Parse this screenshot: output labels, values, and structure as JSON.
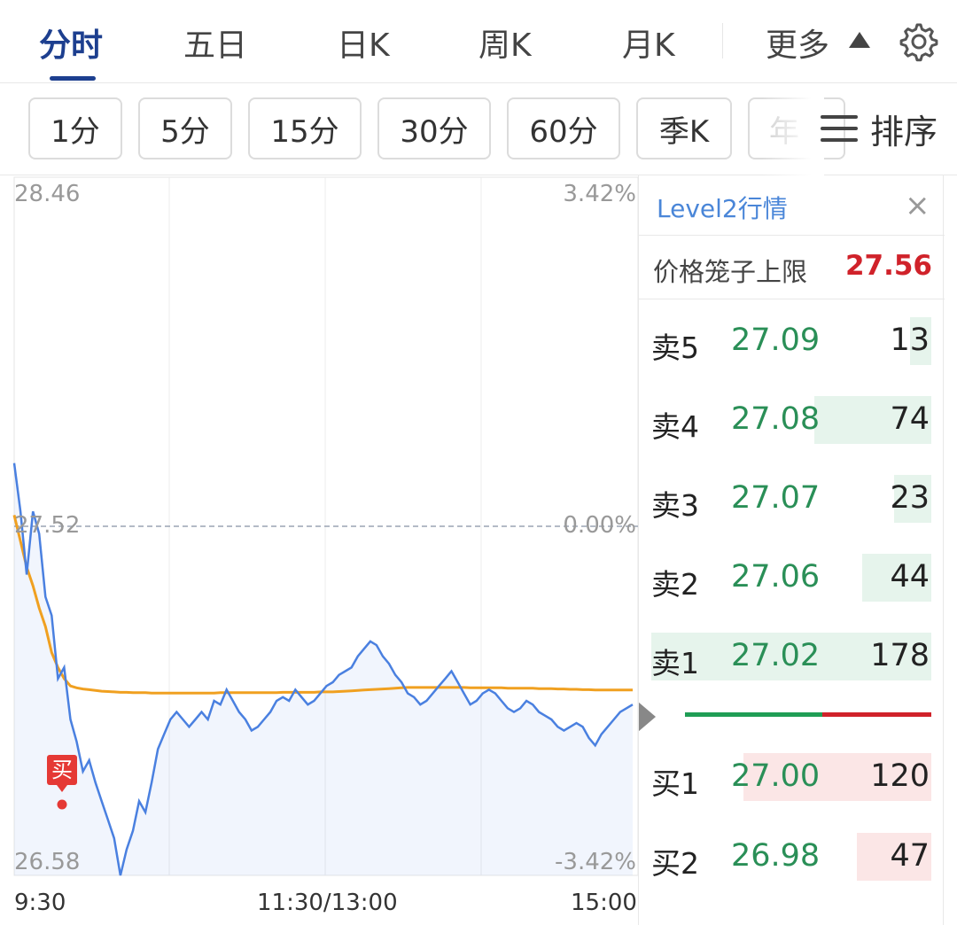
{
  "tabs": [
    {
      "label": "分时",
      "active": true
    },
    {
      "label": "五日"
    },
    {
      "label": "日K"
    },
    {
      "label": "周K"
    },
    {
      "label": "月K"
    },
    {
      "label": "更多"
    }
  ],
  "periods": [
    "1分",
    "5分",
    "15分",
    "30分",
    "60分",
    "季K",
    "年"
  ],
  "sort_label": "排序",
  "chart_data": {
    "type": "line",
    "y_top": "28.46",
    "y_mid": "27.52",
    "y_bottom": "26.58",
    "pct_top": "3.42%",
    "pct_mid": "0.00%",
    "pct_bottom": "-3.42%",
    "ylim": [
      26.58,
      28.46
    ],
    "ref_price": 27.52,
    "x_labels": [
      "9:30",
      "11:30/13:00",
      "15:00"
    ],
    "buy_marker": "买",
    "series": [
      {
        "values": [
          27.69,
          27.56,
          27.39,
          27.56,
          27.5,
          27.33,
          27.28,
          27.11,
          27.14,
          27.0,
          26.94,
          26.86,
          26.89,
          26.83,
          26.78,
          26.73,
          26.68,
          26.58,
          26.65,
          26.7,
          26.78,
          26.75,
          26.83,
          26.92,
          26.96,
          27.0,
          27.02,
          27.0,
          26.98,
          27.0,
          27.02,
          27.0,
          27.05,
          27.04,
          27.08,
          27.05,
          27.02,
          27.0,
          26.97,
          26.98,
          27.0,
          27.02,
          27.05,
          27.06,
          27.05,
          27.08,
          27.06,
          27.04,
          27.05,
          27.07,
          27.09,
          27.1,
          27.12,
          27.13,
          27.14,
          27.17,
          27.19,
          27.21,
          27.2,
          27.17,
          27.15,
          27.12,
          27.1,
          27.07,
          27.06,
          27.04,
          27.05,
          27.07,
          27.09,
          27.11,
          27.13,
          27.1,
          27.07,
          27.04,
          27.05,
          27.07,
          27.08,
          27.07,
          27.05,
          27.03,
          27.02,
          27.03,
          27.05,
          27.04,
          27.02,
          27.01,
          27.0,
          26.98,
          26.97,
          26.98,
          26.99,
          26.98,
          26.95,
          26.93,
          26.96,
          26.98,
          27.0,
          27.02,
          27.03,
          27.04
        ]
      },
      {
        "values": [
          27.55,
          27.48,
          27.41,
          27.36,
          27.3,
          27.25,
          27.18,
          27.14,
          27.11,
          27.09,
          27.085,
          27.082,
          27.08,
          27.078,
          27.076,
          27.075,
          27.074,
          27.073,
          27.073,
          27.072,
          27.072,
          27.072,
          27.071,
          27.071,
          27.071,
          27.071,
          27.071,
          27.071,
          27.071,
          27.071,
          27.071,
          27.071,
          27.071,
          27.072,
          27.072,
          27.072,
          27.072,
          27.072,
          27.072,
          27.072,
          27.072,
          27.072,
          27.072,
          27.073,
          27.073,
          27.073,
          27.073,
          27.073,
          27.073,
          27.074,
          27.074,
          27.074,
          27.075,
          27.076,
          27.077,
          27.078,
          27.079,
          27.08,
          27.081,
          27.082,
          27.083,
          27.084,
          27.085,
          27.086,
          27.086,
          27.086,
          27.086,
          27.086,
          27.086,
          27.086,
          27.086,
          27.086,
          27.086,
          27.085,
          27.085,
          27.085,
          27.085,
          27.085,
          27.085,
          27.084,
          27.084,
          27.084,
          27.084,
          27.084,
          27.083,
          27.083,
          27.083,
          27.082,
          27.082,
          27.081,
          27.081,
          27.08,
          27.08,
          27.079,
          27.079,
          27.079,
          27.079,
          27.079,
          27.079,
          27.079
        ]
      }
    ]
  },
  "book": {
    "title": "Level2行情",
    "close": "×",
    "cage_label": "价格笼子上限",
    "cage_value": "27.56",
    "asks": [
      {
        "label": "卖5",
        "price": "27.09",
        "volume": "13"
      },
      {
        "label": "卖4",
        "price": "27.08",
        "volume": "74"
      },
      {
        "label": "卖3",
        "price": "27.07",
        "volume": "23"
      },
      {
        "label": "卖2",
        "price": "27.06",
        "volume": "44"
      },
      {
        "label": "卖1",
        "price": "27.02",
        "volume": "178"
      }
    ],
    "bids": [
      {
        "label": "买1",
        "price": "27.00",
        "volume": "120"
      },
      {
        "label": "买2",
        "price": "26.98",
        "volume": "47"
      }
    ],
    "ask_bar_color": "#e6f4ec",
    "bid_bar_color": "#fbe6e6",
    "split_green": "#1f9d55",
    "split_red": "#d0222a"
  },
  "colors": {
    "price_line": "#4a80e0",
    "avg_line": "#f0a020",
    "active_tab": "#1d3f8f"
  }
}
